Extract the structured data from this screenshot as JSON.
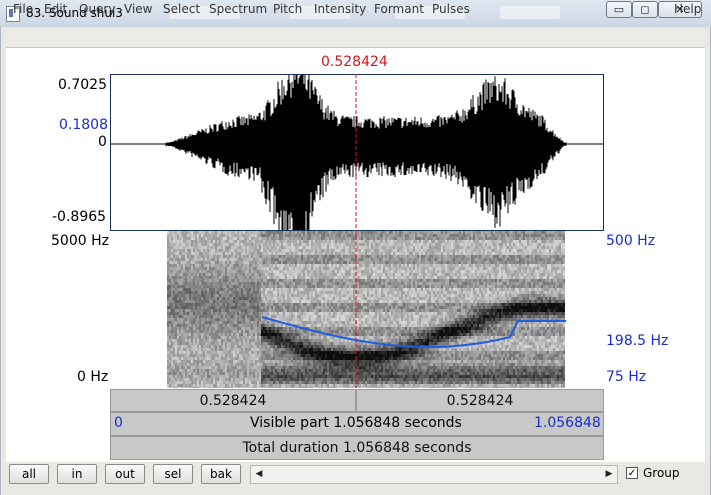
{
  "window": {
    "title": "83. Sound shui3",
    "minimize_glyph": "▭",
    "restore_glyph": "◻",
    "close_glyph": "✕"
  },
  "menu": [
    "File",
    "Edit",
    "Query",
    "View",
    "Select",
    "Spectrum",
    "Pitch",
    "Intensity",
    "Formant",
    "Pulses"
  ],
  "help_label": "Help",
  "cursor_time": "0.528424",
  "waveform": {
    "y_max": "0.7025",
    "y_cursor": "0.1808",
    "y_zero": "0",
    "y_min": "-0.8965"
  },
  "spectrogram": {
    "freq_max": "5000 Hz",
    "freq_min": "0 Hz",
    "pitch_max": "500 Hz",
    "pitch_cursor": "198.5 Hz",
    "pitch_min": "75 Hz"
  },
  "time_bars": {
    "left_segment": "0.528424",
    "right_segment": "0.528424",
    "visible_start": "0",
    "visible_part": "Visible part 1.056848 seconds",
    "visible_end": "1.056848",
    "total_duration": "Total duration 1.056848 seconds"
  },
  "toolbar": {
    "all": "all",
    "in": "in",
    "out": "out",
    "sel": "sel",
    "bak": "bak",
    "group_label": "Group",
    "group_checked": "✓",
    "scroll_left": "◀",
    "scroll_right": "▶"
  },
  "colors": {
    "accent_blue": "#1a2fc7",
    "cursor_red": "#d01818",
    "pitch_track": "#1f5fe0"
  }
}
